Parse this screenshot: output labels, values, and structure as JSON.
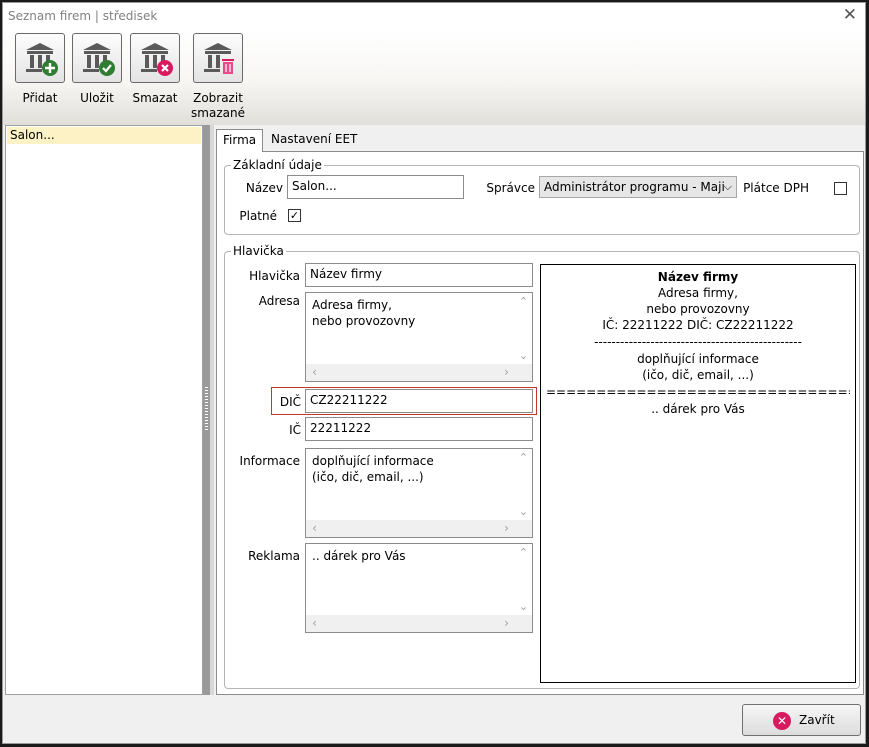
{
  "window": {
    "title": "Seznam firem | středisek"
  },
  "toolbar": {
    "buttons": [
      {
        "label": "Přidat",
        "icon": "bank-add-icon"
      },
      {
        "label": "Uložit",
        "icon": "bank-save-icon"
      },
      {
        "label": "Smazat",
        "icon": "bank-delete-icon"
      },
      {
        "label": "Zobrazit\nsmazané",
        "icon": "bank-trash-icon"
      }
    ]
  },
  "company_list": {
    "items": [
      "Salon..."
    ]
  },
  "tabs": [
    {
      "label": "Firma",
      "active": true
    },
    {
      "label": "Nastavení EET",
      "active": false
    }
  ],
  "basic": {
    "legend": "Základní údaje",
    "name_label": "Název",
    "name_value": "Salon...",
    "admin_label": "Správce",
    "admin_value": "Administrátor programu - Maji",
    "vat_label": "Plátce DPH",
    "vat_checked": false,
    "valid_label": "Platné",
    "valid_checked": true
  },
  "header": {
    "legend": "Hlavička",
    "hlavicka_label": "Hlavička",
    "hlavicka_value": "Název firmy",
    "adresa_label": "Adresa",
    "adresa_value": "Adresa firmy,\nnebo provozovny",
    "dic_label": "DIČ",
    "dic_value": "CZ22211222",
    "ic_label": "IČ",
    "ic_value": "22211222",
    "informace_label": "Informace",
    "informace_value": "doplňující informace\n(ičo, dič, email, ...)",
    "reklama_label": "Reklama",
    "reklama_value": ".. dárek pro Vás"
  },
  "preview": {
    "title": "Název firmy",
    "address1": "Adresa firmy,",
    "address2": "nebo provozovny",
    "ids": "IČ: 22211222 DIČ: CZ22211222",
    "dash": "------------------------------------------------",
    "info1": "doplňující informace",
    "info2": "(ičo, dič, email, ...)",
    "double": "================================",
    "ad": ".. dárek pro Vás"
  },
  "footer": {
    "close_label": "Zavřít"
  },
  "colors": {
    "selected_row": "#fdf2c6",
    "error_border": "#c0392b",
    "close_icon": "#d81b60",
    "add_green": "#2e7d32"
  }
}
